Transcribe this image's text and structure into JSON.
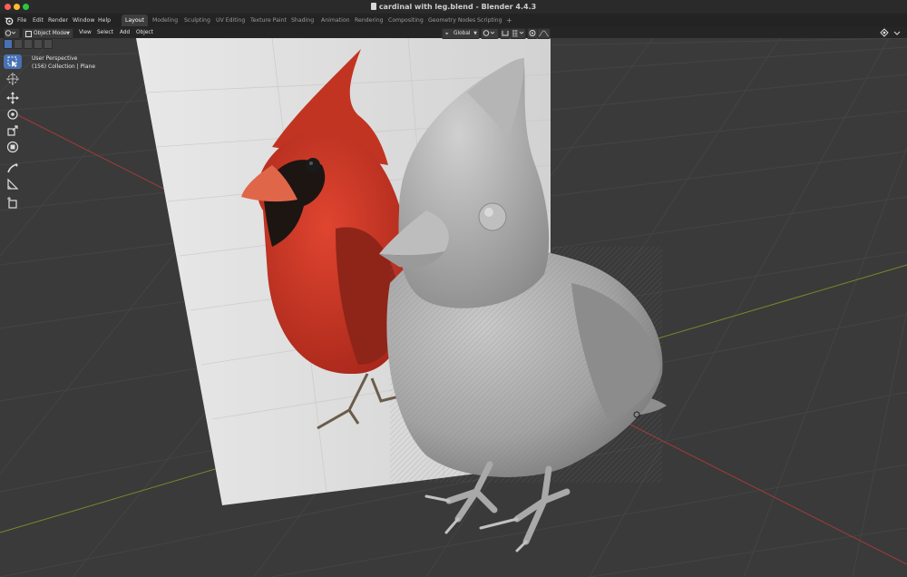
{
  "window": {
    "title": "cardinal with leg.blend - Blender 4.4.3",
    "traffic_colors": [
      "#ff5f57",
      "#febc2e",
      "#28c840"
    ]
  },
  "menus": [
    "File",
    "Edit",
    "Render",
    "Window",
    "Help"
  ],
  "workspaces": [
    {
      "label": "Layout",
      "active": true
    },
    {
      "label": "Modeling",
      "active": false
    },
    {
      "label": "Sculpting",
      "active": false
    },
    {
      "label": "UV Editing",
      "active": false
    },
    {
      "label": "Texture Paint",
      "active": false
    },
    {
      "label": "Shading",
      "active": false
    },
    {
      "label": "Animation",
      "active": false
    },
    {
      "label": "Rendering",
      "active": false
    },
    {
      "label": "Compositing",
      "active": false
    },
    {
      "label": "Geometry Nodes",
      "active": false
    },
    {
      "label": "Scripting",
      "active": false
    }
  ],
  "add_workspace": "+",
  "viewport_header": {
    "mode": "Object Mode",
    "menus": [
      "View",
      "Select",
      "Add",
      "Object"
    ],
    "transform_orientation": "Global"
  },
  "viewport": {
    "perspective": "User Perspective",
    "collection_info": "(156) Collection | Plane"
  },
  "tools": [
    {
      "icon": "select-box-icon",
      "active": true
    },
    {
      "icon": "cursor-icon",
      "active": false
    },
    {
      "icon": "move-icon",
      "active": false
    },
    {
      "icon": "rotate-icon",
      "active": false
    },
    {
      "icon": "scale-icon",
      "active": false
    },
    {
      "icon": "transform-icon",
      "active": false
    },
    {
      "icon": "annotate-icon",
      "active": false
    },
    {
      "icon": "measure-icon",
      "active": false
    },
    {
      "icon": "add-cube-icon",
      "active": false
    }
  ],
  "colors": {
    "accent": "#4772b3",
    "cardinal_red": "#d63a28",
    "grid_axis_x": "#a33a3a",
    "grid_axis_y": "#7a8a2a"
  }
}
